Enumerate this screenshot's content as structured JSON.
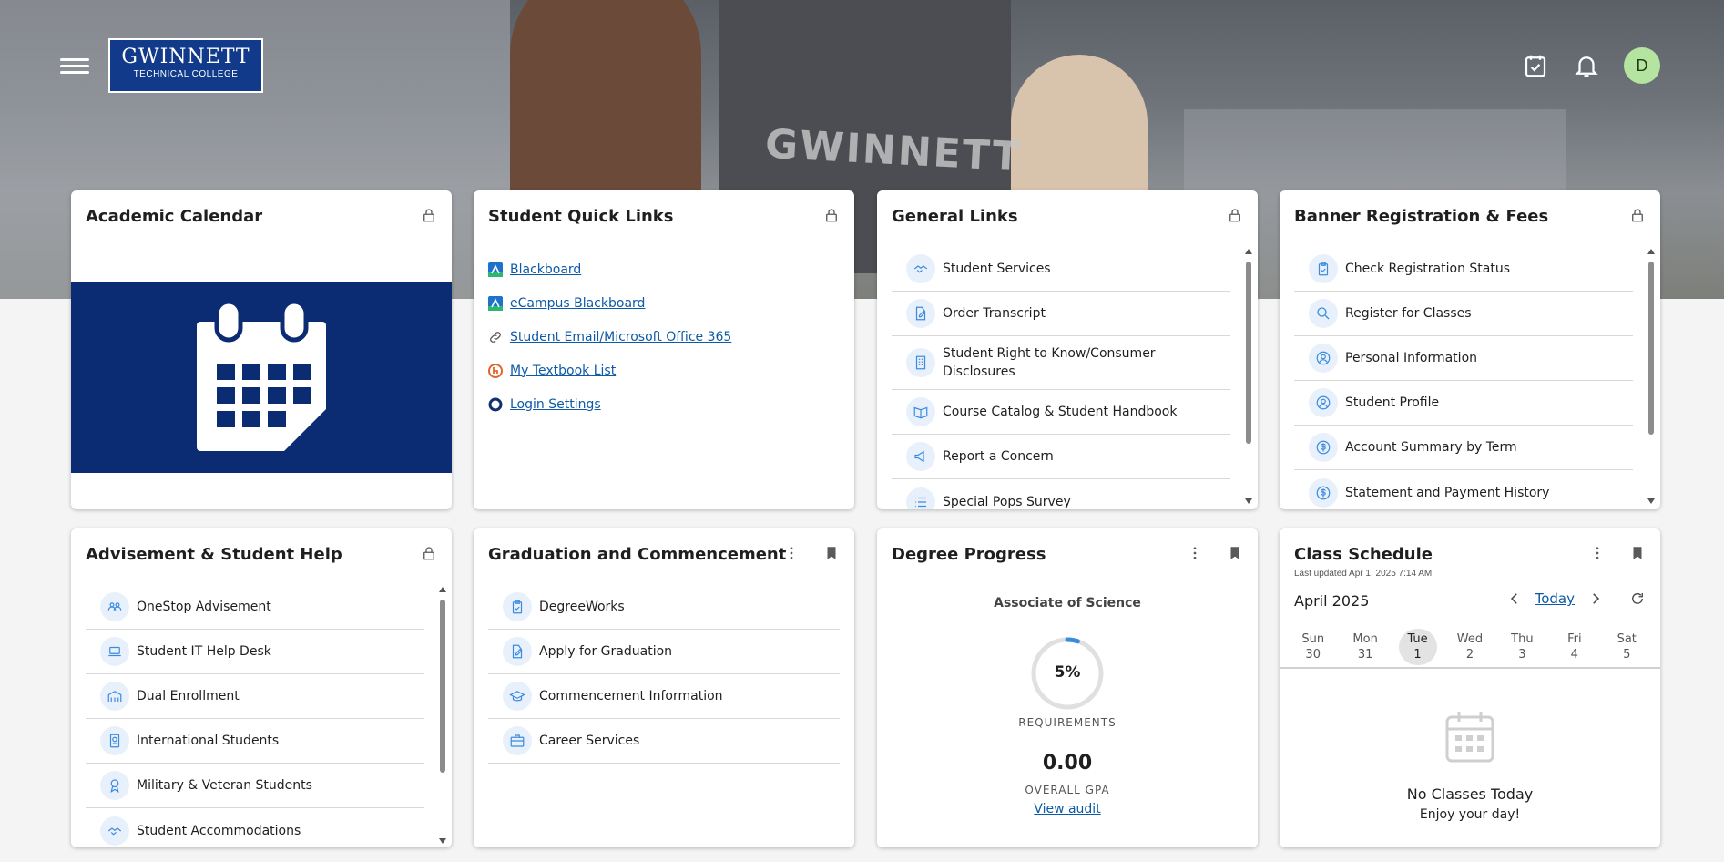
{
  "header": {
    "logo_line1": "GWINNETT",
    "logo_line2": "TECHNICAL COLLEGE",
    "hero_text": "GWINNETT",
    "avatar_initial": "D",
    "icons": [
      "menu-icon",
      "calendar-check-icon",
      "bell-icon"
    ]
  },
  "academic_calendar": {
    "title": "Academic Calendar"
  },
  "student_quick_links": {
    "title": "Student Quick Links",
    "links": [
      {
        "label": "Blackboard",
        "icon": "blackboard-icon"
      },
      {
        "label": "eCampus Blackboard",
        "icon": "blackboard-icon"
      },
      {
        "label": "Student Email/Microsoft Office 365",
        "icon": "link-icon"
      },
      {
        "label": "My Textbook List",
        "icon": "textbook-icon"
      },
      {
        "label": "Login Settings",
        "icon": "settings-ring-icon"
      }
    ]
  },
  "general_links": {
    "title": "General Links",
    "items": [
      {
        "label": "Student Services",
        "icon": "handshake-icon"
      },
      {
        "label": "Order Transcript",
        "icon": "document-edit-icon"
      },
      {
        "label": "Student Right to Know/Consumer Disclosures",
        "icon": "building-icon"
      },
      {
        "label": "Course Catalog & Student Handbook",
        "icon": "book-open-icon"
      },
      {
        "label": "Report a Concern",
        "icon": "megaphone-icon"
      },
      {
        "label": "Special Pops Survey",
        "icon": "list-icon"
      }
    ]
  },
  "banner_registration": {
    "title": "Banner Registration & Fees",
    "items": [
      {
        "label": "Check Registration Status",
        "icon": "clipboard-check-icon"
      },
      {
        "label": "Register for Classes",
        "icon": "search-icon"
      },
      {
        "label": "Personal Information",
        "icon": "user-circle-icon"
      },
      {
        "label": "Student Profile",
        "icon": "user-circle-icon"
      },
      {
        "label": "Account Summary by Term",
        "icon": "dollar-circle-icon"
      },
      {
        "label": "Statement and Payment History",
        "icon": "dollar-circle-icon"
      }
    ]
  },
  "advisement": {
    "title": "Advisement & Student Help",
    "items": [
      {
        "label": "OneStop Advisement",
        "icon": "group-icon"
      },
      {
        "label": "Student IT Help Desk",
        "icon": "laptop-icon"
      },
      {
        "label": "Dual Enrollment",
        "icon": "school-building-icon"
      },
      {
        "label": "International Students",
        "icon": "passport-icon"
      },
      {
        "label": "Military & Veteran Students",
        "icon": "medal-icon"
      },
      {
        "label": "Student Accommodations",
        "icon": "handshake-icon"
      }
    ]
  },
  "graduation": {
    "title": "Graduation and Commencement",
    "items": [
      {
        "label": "DegreeWorks",
        "icon": "clipboard-check-icon"
      },
      {
        "label": "Apply for Graduation",
        "icon": "document-edit-icon"
      },
      {
        "label": "Commencement Information",
        "icon": "graduation-cap-icon"
      },
      {
        "label": "Career Services",
        "icon": "briefcase-icon"
      }
    ]
  },
  "degree_progress": {
    "title": "Degree Progress",
    "degree": "Associate of Science",
    "percent_label": "5%",
    "percent_value": 5,
    "requirements_label": "REQUIREMENTS",
    "gpa": "0.00",
    "gpa_label": "OVERALL GPA",
    "audit_link": "View audit"
  },
  "class_schedule": {
    "title": "Class Schedule",
    "last_updated": "Last updated Apr 1, 2025 7:14 AM",
    "month": "April 2025",
    "today_label": "Today",
    "days": [
      {
        "name": "Sun",
        "num": "30"
      },
      {
        "name": "Mon",
        "num": "31"
      },
      {
        "name": "Tue",
        "num": "1",
        "selected": true
      },
      {
        "name": "Wed",
        "num": "2"
      },
      {
        "name": "Thu",
        "num": "3"
      },
      {
        "name": "Fri",
        "num": "4"
      },
      {
        "name": "Sat",
        "num": "5"
      }
    ],
    "empty_title": "No Classes Today",
    "empty_sub": "Enjoy your day!"
  },
  "colors": {
    "accent_blue": "#0d5aa7",
    "calendar_banner": "#0b2c73",
    "icon_bubble": "#e8f1fb",
    "avatar_bg": "#b5e3a0"
  }
}
